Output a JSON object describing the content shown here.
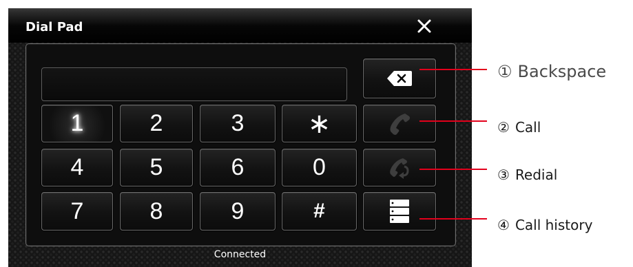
{
  "window": {
    "title": "Dial Pad"
  },
  "display": {
    "value": ""
  },
  "keys": [
    "1",
    "2",
    "3",
    "∗",
    "4",
    "5",
    "6",
    "0",
    "7",
    "8",
    "9",
    "#"
  ],
  "status": "Connected",
  "callouts": [
    {
      "num": "①",
      "label": "Backspace"
    },
    {
      "num": "②",
      "label": "Call"
    },
    {
      "num": "③",
      "label": "Redial"
    },
    {
      "num": "④",
      "label": "Call history"
    }
  ],
  "colors": {
    "leader": "#e3001b",
    "background": "#161616",
    "disabled_icon": "#3e3e3e"
  }
}
